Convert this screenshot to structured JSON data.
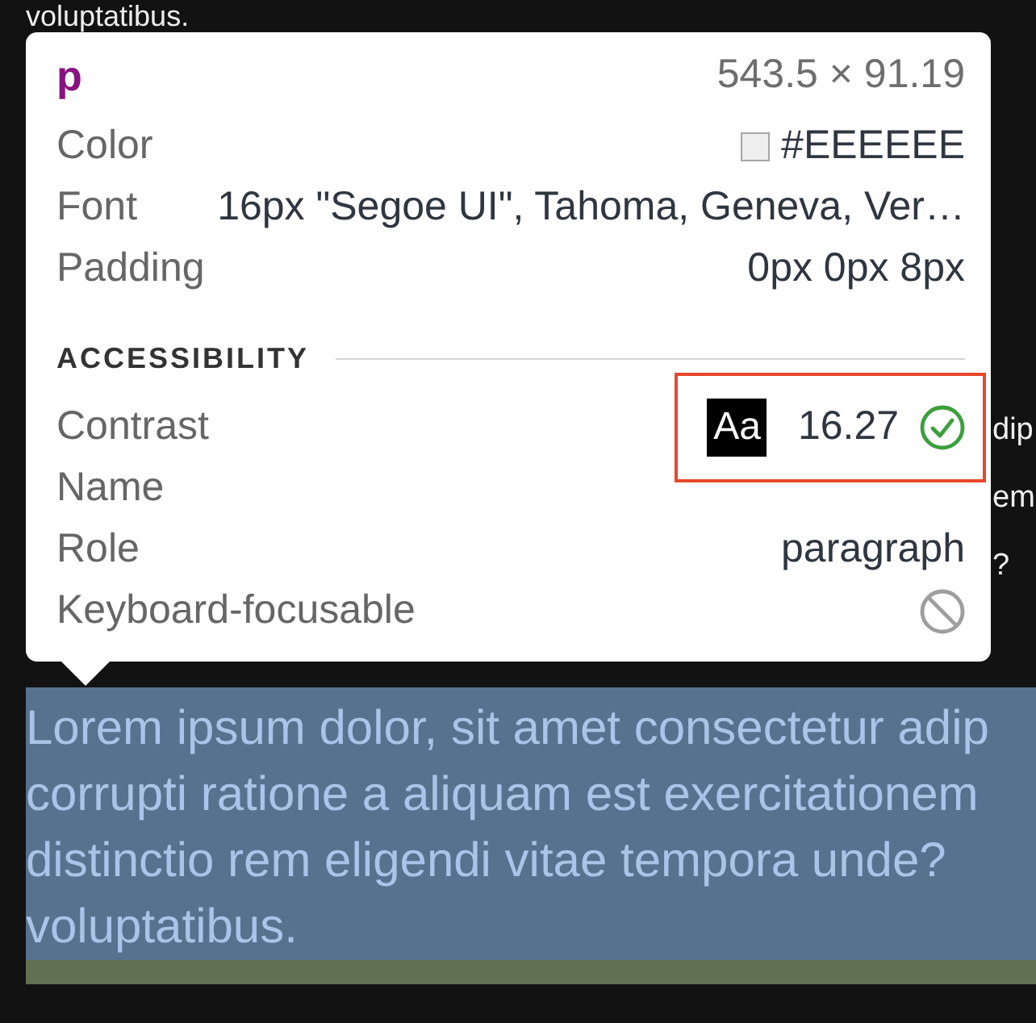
{
  "page_text": {
    "top_line": "voluptatibus.",
    "fragments": [
      "dip",
      "em",
      "?"
    ]
  },
  "tooltip": {
    "tag": "p",
    "size": "543.5 × 91.19",
    "properties": [
      {
        "label": "Color",
        "kind": "color",
        "value": "#EEEEEE",
        "color": "#eeeeee"
      },
      {
        "label": "Font",
        "kind": "text",
        "value": "16px \"Segoe UI\", Tahoma, Geneva, Ver…"
      },
      {
        "label": "Padding",
        "kind": "text",
        "value": "0px 0px 8px"
      }
    ],
    "accessibility": {
      "title": "ACCESSIBILITY",
      "rows": [
        {
          "label": "Contrast",
          "kind": "contrast",
          "sample": "Aa",
          "value": "16.27",
          "passes": true,
          "highlighted": true
        },
        {
          "label": "Name",
          "kind": "text",
          "highlighted": false
        },
        {
          "label": "Role",
          "kind": "text",
          "value": "paragraph",
          "highlighted": false
        },
        {
          "label": "Keyboard-focusable",
          "kind": "boolean",
          "value": false,
          "highlighted": false
        }
      ]
    }
  },
  "highlighted_element": {
    "lines": [
      "Lorem ipsum dolor, sit amet consectetur adip",
      "corrupti ratione a aliquam est exercitationem",
      "distinctio rem eligendi vitae tempora unde?",
      "voluptatibus."
    ]
  }
}
